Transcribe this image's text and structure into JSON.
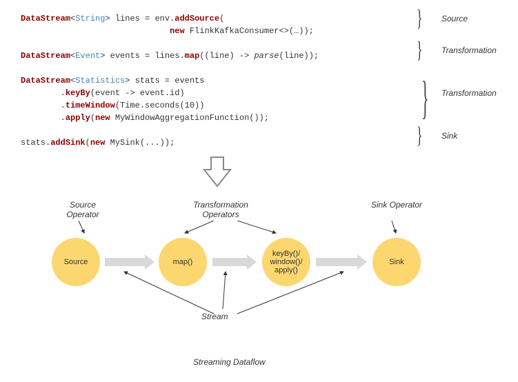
{
  "code": {
    "l1a": "DataStream",
    "l1b": "String",
    "l1c": " lines = env.",
    "l1d": "addSource",
    "l1e": "(",
    "l2a": "                              ",
    "l2b": "new",
    "l2c": " FlinkKafkaConsumer<>(…));",
    "l3": " ",
    "l4a": "DataStream",
    "l4b": "Event",
    "l4c": " events = lines.",
    "l4d": "map",
    "l4e": "((line) -> ",
    "l4f": "parse",
    "l4g": "(line));",
    "l5": " ",
    "l6a": "DataStream",
    "l6b": "Statistics",
    "l6c": " stats = events",
    "l7a": "        .",
    "l7b": "keyBy",
    "l7c": "(event -> event.id)",
    "l8a": "        .",
    "l8b": "timeWindow",
    "l8c": "(Time.seconds(10))",
    "l9a": "        .",
    "l9b": "apply",
    "l9c": "(",
    "l9d": "new",
    "l9e": " MyWindowAggregationFunction());",
    "l10": " ",
    "l11a": "stats.",
    "l11b": "addSink",
    "l11c": "(",
    "l11d": "new",
    "l11e": " MySink(...));"
  },
  "labels": {
    "source": "Source",
    "transformation": "Transformation",
    "sink": "Sink"
  },
  "diagram": {
    "sourceOp": "Source\nOperator",
    "transOp": "Transformation\nOperators",
    "sinkOp": "Sink\nOperator",
    "nodeSource": "Source",
    "nodeMap": "map()",
    "nodeKey": "keyBy()/\nwindow()/\napply()",
    "nodeSink": "Sink",
    "stream": "Stream",
    "dataflow": "Streaming Dataflow"
  }
}
